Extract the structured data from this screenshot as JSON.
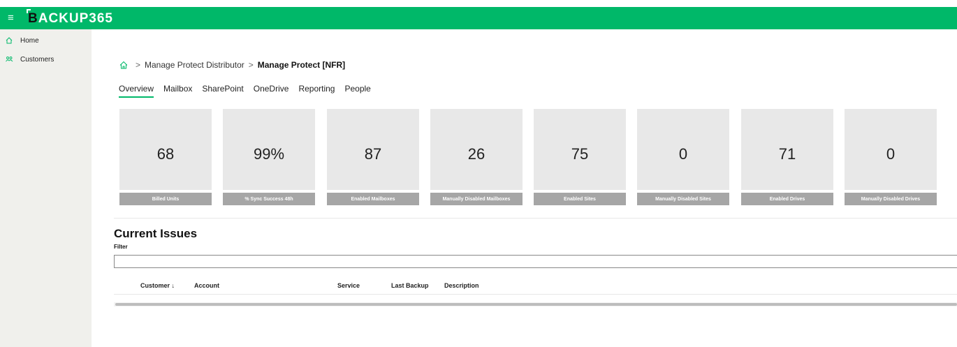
{
  "header": {
    "logo_dark": "B",
    "logo_light": "ACKUP365",
    "logo_text": "BACKUP365",
    "menu_icon": "hamburger-icon",
    "background": "#00b869"
  },
  "sidebar": {
    "items": [
      {
        "label": "Home",
        "icon": "home-icon"
      },
      {
        "label": "Customers",
        "icon": "people-icon"
      }
    ]
  },
  "breadcrumb": {
    "home_icon": "home-icon",
    "separator": ">",
    "items": [
      "Manage Protect Distributor",
      "Manage Protect [NFR]"
    ]
  },
  "tabs": [
    {
      "label": "Overview",
      "active": true
    },
    {
      "label": "Mailbox",
      "active": false
    },
    {
      "label": "SharePoint",
      "active": false
    },
    {
      "label": "OneDrive",
      "active": false
    },
    {
      "label": "Reporting",
      "active": false
    },
    {
      "label": "People",
      "active": false
    }
  ],
  "cards": [
    {
      "value": "68",
      "label": "Billed Units"
    },
    {
      "value": "99%",
      "label": "% Sync Success 48h"
    },
    {
      "value": "87",
      "label": "Enabled Mailboxes"
    },
    {
      "value": "26",
      "label": "Manually Disabled Mailboxes"
    },
    {
      "value": "75",
      "label": "Enabled Sites"
    },
    {
      "value": "0",
      "label": "Manually Disabled Sites"
    },
    {
      "value": "71",
      "label": "Enabled Drives"
    },
    {
      "value": "0",
      "label": "Manually Disabled Drives"
    }
  ],
  "issues": {
    "title": "Current Issues",
    "filter_label": "Filter",
    "filter_value": "",
    "columns": [
      "Customer ↓",
      "Account",
      "Service",
      "Last Backup",
      "Description"
    ],
    "rows": []
  },
  "colors": {
    "accent": "#00b869",
    "card_bg": "#e8e8e8",
    "card_label_bg": "#a6a6a6",
    "sidebar_bg": "#f0f0ec"
  }
}
